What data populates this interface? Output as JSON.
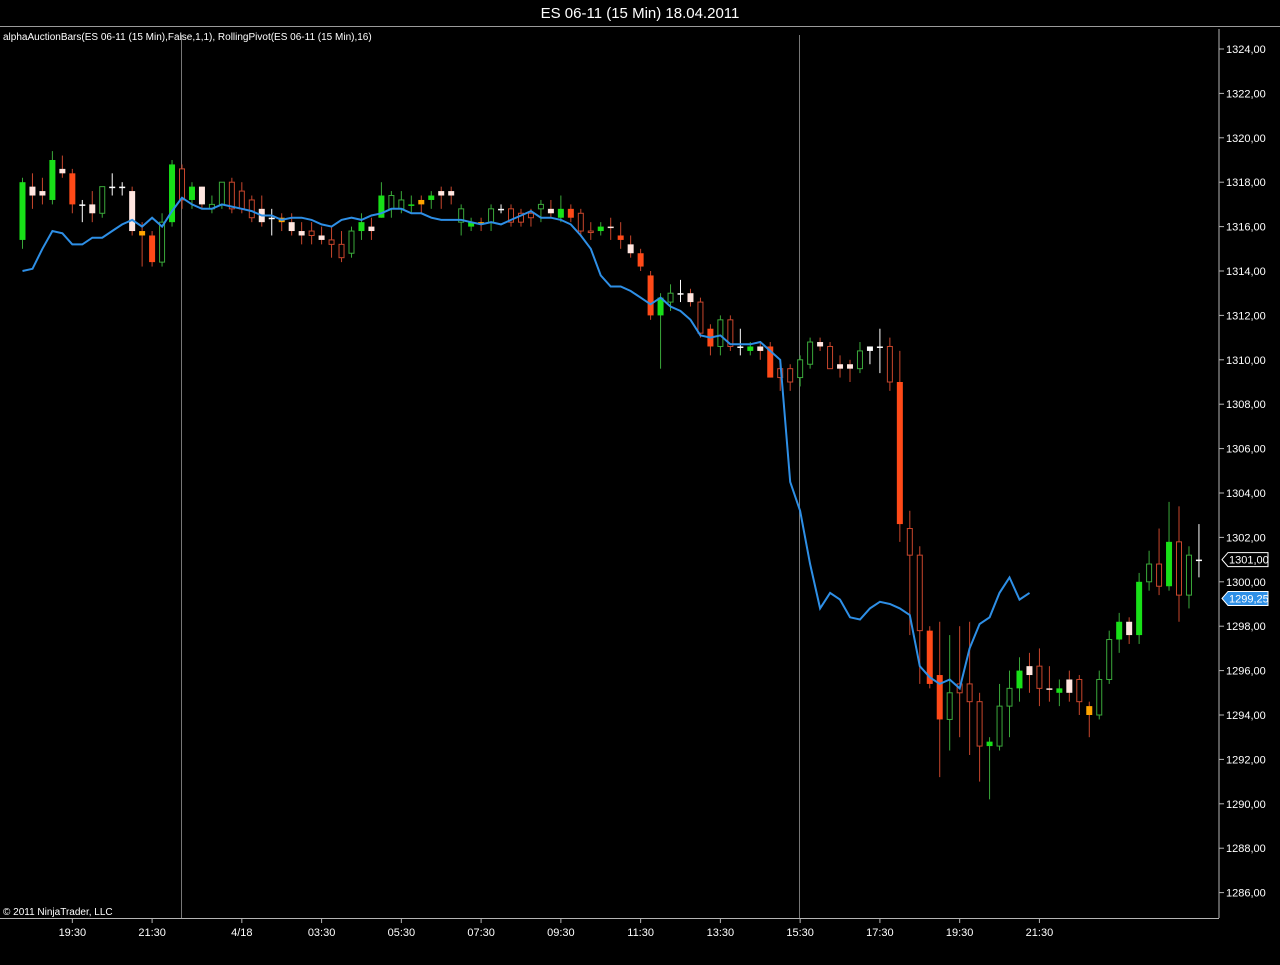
{
  "window": {
    "title": "ES 06-11 (15 Min)  18.04.2011"
  },
  "indicator_label": "alphaAuctionBars(ES 06-11 (15 Min),False,1,1), RollingPivot(ES 06-11 (15 Min),16)",
  "copyright": "© 2011 NinjaTrader, LLC",
  "price_markers": {
    "last_price": "1301,00",
    "pivot_value": "1299,25"
  },
  "colors": {
    "background": "#000000",
    "bull_strong": "#18e018",
    "bear_strong": "#ff4a18",
    "bull_wick": "#3aa83a",
    "bear_wick": "#c8462c",
    "neutral_body": "#ffe6e0",
    "pivot_line": "#2e8fe6",
    "axis_frame": "#b4b4b4",
    "session_line": "#777777"
  },
  "chart_data": {
    "type": "candlestick",
    "title": "ES 06-11 (15 Min)  18.04.2011",
    "instrument": "ES 06-11",
    "ylim": [
      1285,
      1325
    ],
    "grid": false,
    "y_ticks": [
      "1324,00",
      "1322,00",
      "1320,00",
      "1318,00",
      "1316,00",
      "1314,00",
      "1312,00",
      "1310,00",
      "1308,00",
      "1306,00",
      "1304,00",
      "1302,00",
      "1300,00",
      "1298,00",
      "1296,00",
      "1294,00",
      "1292,00",
      "1290,00",
      "1288,00",
      "1286,00"
    ],
    "x_tick_labels": [
      {
        "label": "19:30",
        "bar": 5
      },
      {
        "label": "21:30",
        "bar": 13
      },
      {
        "label": "4/18",
        "bar": 22
      },
      {
        "label": "03:30",
        "bar": 30
      },
      {
        "label": "05:30",
        "bar": 38
      },
      {
        "label": "07:30",
        "bar": 46
      },
      {
        "label": "09:30",
        "bar": 54
      },
      {
        "label": "11:30",
        "bar": 62
      },
      {
        "label": "13:30",
        "bar": 70
      },
      {
        "label": "15:30",
        "bar": 78
      },
      {
        "label": "17:30",
        "bar": 86
      },
      {
        "label": "19:30",
        "bar": 94
      },
      {
        "label": "21:30",
        "bar": 102
      }
    ],
    "session_break_bars": [
      16,
      78
    ],
    "candles": [
      {
        "o": 1315.4,
        "h": 1318.2,
        "l": 1315.0,
        "c": 1318.0,
        "k": "bull"
      },
      {
        "o": 1317.8,
        "h": 1318.4,
        "l": 1316.8,
        "c": 1317.4,
        "k": "neutral"
      },
      {
        "o": 1317.6,
        "h": 1318.2,
        "l": 1317.0,
        "c": 1317.4,
        "k": "neutral"
      },
      {
        "o": 1317.2,
        "h": 1319.4,
        "l": 1317.0,
        "c": 1319.0,
        "k": "bull"
      },
      {
        "o": 1318.6,
        "h": 1319.2,
        "l": 1318.2,
        "c": 1318.4,
        "k": "neutral"
      },
      {
        "o": 1318.4,
        "h": 1318.6,
        "l": 1316.6,
        "c": 1317.0,
        "k": "bear"
      },
      {
        "o": 1317.0,
        "h": 1317.2,
        "l": 1316.2,
        "c": 1317.0,
        "k": "doji"
      },
      {
        "o": 1317.0,
        "h": 1317.6,
        "l": 1316.2,
        "c": 1316.6,
        "k": "neutral"
      },
      {
        "o": 1316.6,
        "h": 1317.8,
        "l": 1316.4,
        "c": 1317.8,
        "k": "bull_hollow"
      },
      {
        "o": 1317.8,
        "h": 1318.4,
        "l": 1317.4,
        "c": 1317.8,
        "k": "doji"
      },
      {
        "o": 1317.8,
        "h": 1318.0,
        "l": 1317.4,
        "c": 1317.8,
        "k": "doji"
      },
      {
        "o": 1317.6,
        "h": 1317.8,
        "l": 1315.6,
        "c": 1315.8,
        "k": "neutral"
      },
      {
        "o": 1315.8,
        "h": 1316.2,
        "l": 1314.2,
        "c": 1315.6,
        "k": "neutral_orange"
      },
      {
        "o": 1315.6,
        "h": 1315.8,
        "l": 1314.2,
        "c": 1314.4,
        "k": "bear"
      },
      {
        "o": 1314.4,
        "h": 1316.6,
        "l": 1314.2,
        "c": 1316.2,
        "k": "bull_hollow"
      },
      {
        "o": 1316.2,
        "h": 1319.0,
        "l": 1316.0,
        "c": 1318.8,
        "k": "bull"
      },
      {
        "o": 1318.6,
        "h": 1318.8,
        "l": 1316.8,
        "c": 1317.2,
        "k": "bear_hollow"
      },
      {
        "o": 1317.2,
        "h": 1318.0,
        "l": 1316.8,
        "c": 1317.8,
        "k": "bull"
      },
      {
        "o": 1317.8,
        "h": 1317.8,
        "l": 1316.8,
        "c": 1317.0,
        "k": "neutral"
      },
      {
        "o": 1316.8,
        "h": 1317.4,
        "l": 1316.6,
        "c": 1317.0,
        "k": "bull_hollow"
      },
      {
        "o": 1317.0,
        "h": 1318.0,
        "l": 1316.8,
        "c": 1318.0,
        "k": "bull_hollow"
      },
      {
        "o": 1318.0,
        "h": 1318.2,
        "l": 1316.6,
        "c": 1316.8,
        "k": "bear_hollow"
      },
      {
        "o": 1316.8,
        "h": 1318.0,
        "l": 1316.6,
        "c": 1317.6,
        "k": "bear_hollow"
      },
      {
        "o": 1317.2,
        "h": 1317.4,
        "l": 1316.2,
        "c": 1316.4,
        "k": "bear_hollow"
      },
      {
        "o": 1316.8,
        "h": 1317.4,
        "l": 1316.0,
        "c": 1316.2,
        "k": "neutral"
      },
      {
        "o": 1316.4,
        "h": 1316.8,
        "l": 1315.6,
        "c": 1316.4,
        "k": "doji"
      },
      {
        "o": 1316.4,
        "h": 1316.6,
        "l": 1315.8,
        "c": 1316.2,
        "k": "neutral_orange"
      },
      {
        "o": 1316.2,
        "h": 1316.6,
        "l": 1315.6,
        "c": 1315.8,
        "k": "neutral"
      },
      {
        "o": 1315.8,
        "h": 1316.2,
        "l": 1315.2,
        "c": 1315.6,
        "k": "neutral"
      },
      {
        "o": 1315.6,
        "h": 1316.2,
        "l": 1315.2,
        "c": 1315.8,
        "k": "bear_hollow"
      },
      {
        "o": 1315.6,
        "h": 1316.0,
        "l": 1315.2,
        "c": 1315.4,
        "k": "neutral"
      },
      {
        "o": 1315.4,
        "h": 1316.0,
        "l": 1314.6,
        "c": 1315.2,
        "k": "bear_hollow"
      },
      {
        "o": 1314.6,
        "h": 1315.8,
        "l": 1314.4,
        "c": 1315.2,
        "k": "bear_hollow"
      },
      {
        "o": 1314.8,
        "h": 1316.0,
        "l": 1314.6,
        "c": 1315.8,
        "k": "bull_hollow"
      },
      {
        "o": 1315.8,
        "h": 1316.6,
        "l": 1315.4,
        "c": 1316.2,
        "k": "bull"
      },
      {
        "o": 1315.8,
        "h": 1316.4,
        "l": 1315.4,
        "c": 1316.0,
        "k": "neutral"
      },
      {
        "o": 1316.4,
        "h": 1318.0,
        "l": 1316.4,
        "c": 1317.4,
        "k": "bull"
      },
      {
        "o": 1317.4,
        "h": 1317.6,
        "l": 1316.4,
        "c": 1316.8,
        "k": "bull_hollow"
      },
      {
        "o": 1316.8,
        "h": 1317.6,
        "l": 1316.6,
        "c": 1317.2,
        "k": "bull_hollow"
      },
      {
        "o": 1317.0,
        "h": 1317.4,
        "l": 1316.6,
        "c": 1317.0,
        "k": "bull"
      },
      {
        "o": 1317.2,
        "h": 1317.4,
        "l": 1316.6,
        "c": 1317.0,
        "k": "neutral_orange"
      },
      {
        "o": 1317.2,
        "h": 1317.6,
        "l": 1316.8,
        "c": 1317.4,
        "k": "bull"
      },
      {
        "o": 1317.4,
        "h": 1317.8,
        "l": 1316.8,
        "c": 1317.6,
        "k": "neutral"
      },
      {
        "o": 1317.4,
        "h": 1317.8,
        "l": 1317.0,
        "c": 1317.6,
        "k": "neutral"
      },
      {
        "o": 1316.8,
        "h": 1317.0,
        "l": 1315.6,
        "c": 1316.2,
        "k": "bull_hollow"
      },
      {
        "o": 1316.0,
        "h": 1316.4,
        "l": 1315.8,
        "c": 1316.2,
        "k": "bull"
      },
      {
        "o": 1316.2,
        "h": 1316.4,
        "l": 1315.8,
        "c": 1316.2,
        "k": "neutral_orange"
      },
      {
        "o": 1316.2,
        "h": 1317.0,
        "l": 1315.8,
        "c": 1316.8,
        "k": "bull_hollow"
      },
      {
        "o": 1316.8,
        "h": 1317.0,
        "l": 1316.6,
        "c": 1316.8,
        "k": "doji"
      },
      {
        "o": 1316.8,
        "h": 1317.0,
        "l": 1316.0,
        "c": 1316.2,
        "k": "bear_hollow"
      },
      {
        "o": 1316.2,
        "h": 1316.8,
        "l": 1316.0,
        "c": 1316.6,
        "k": "bear_hollow"
      },
      {
        "o": 1316.6,
        "h": 1316.8,
        "l": 1316.0,
        "c": 1316.4,
        "k": "bear_hollow"
      },
      {
        "o": 1316.8,
        "h": 1317.2,
        "l": 1316.2,
        "c": 1317.0,
        "k": "bull_hollow"
      },
      {
        "o": 1316.6,
        "h": 1317.2,
        "l": 1316.4,
        "c": 1316.8,
        "k": "neutral"
      },
      {
        "o": 1316.4,
        "h": 1317.4,
        "l": 1316.2,
        "c": 1316.8,
        "k": "bull"
      },
      {
        "o": 1316.8,
        "h": 1317.0,
        "l": 1316.2,
        "c": 1316.4,
        "k": "bear"
      },
      {
        "o": 1316.6,
        "h": 1316.8,
        "l": 1315.6,
        "c": 1315.8,
        "k": "bear_hollow"
      },
      {
        "o": 1315.8,
        "h": 1316.2,
        "l": 1315.4,
        "c": 1315.8,
        "k": "bear_hollow"
      },
      {
        "o": 1316.0,
        "h": 1316.2,
        "l": 1315.6,
        "c": 1315.8,
        "k": "bull"
      },
      {
        "o": 1316.0,
        "h": 1316.4,
        "l": 1315.4,
        "c": 1316.0,
        "k": "neutral"
      },
      {
        "o": 1315.6,
        "h": 1316.2,
        "l": 1315.0,
        "c": 1315.4,
        "k": "bear"
      },
      {
        "o": 1315.2,
        "h": 1315.6,
        "l": 1314.6,
        "c": 1314.8,
        "k": "neutral"
      },
      {
        "o": 1314.8,
        "h": 1315.0,
        "l": 1314.0,
        "c": 1314.2,
        "k": "bear"
      },
      {
        "o": 1313.8,
        "h": 1314.0,
        "l": 1311.8,
        "c": 1312.0,
        "k": "bear"
      },
      {
        "o": 1312.0,
        "h": 1313.0,
        "l": 1309.6,
        "c": 1312.8,
        "k": "bull"
      },
      {
        "o": 1312.6,
        "h": 1313.4,
        "l": 1312.2,
        "c": 1313.0,
        "k": "bull_hollow"
      },
      {
        "o": 1313.0,
        "h": 1313.6,
        "l": 1312.6,
        "c": 1313.0,
        "k": "doji"
      },
      {
        "o": 1313.0,
        "h": 1313.2,
        "l": 1312.4,
        "c": 1312.6,
        "k": "neutral"
      },
      {
        "o": 1312.6,
        "h": 1312.8,
        "l": 1311.0,
        "c": 1311.2,
        "k": "bear_hollow"
      },
      {
        "o": 1311.4,
        "h": 1311.6,
        "l": 1310.2,
        "c": 1310.6,
        "k": "bear"
      },
      {
        "o": 1310.6,
        "h": 1312.0,
        "l": 1310.2,
        "c": 1311.8,
        "k": "bull_hollow"
      },
      {
        "o": 1311.8,
        "h": 1312.0,
        "l": 1310.4,
        "c": 1310.6,
        "k": "bear_hollow"
      },
      {
        "o": 1310.6,
        "h": 1311.4,
        "l": 1310.2,
        "c": 1310.6,
        "k": "doji"
      },
      {
        "o": 1310.6,
        "h": 1310.8,
        "l": 1310.2,
        "c": 1310.4,
        "k": "bull"
      },
      {
        "o": 1310.4,
        "h": 1310.8,
        "l": 1310.0,
        "c": 1310.6,
        "k": "neutral"
      },
      {
        "o": 1310.6,
        "h": 1310.8,
        "l": 1309.2,
        "c": 1309.2,
        "k": "bear"
      },
      {
        "o": 1309.2,
        "h": 1309.8,
        "l": 1308.6,
        "c": 1309.6,
        "k": "bear_hollow"
      },
      {
        "o": 1309.6,
        "h": 1309.8,
        "l": 1308.6,
        "c": 1309.0,
        "k": "bear_hollow"
      },
      {
        "o": 1309.2,
        "h": 1310.2,
        "l": 1308.8,
        "c": 1310.0,
        "k": "bull_hollow"
      },
      {
        "o": 1309.8,
        "h": 1311.0,
        "l": 1309.6,
        "c": 1310.8,
        "k": "bull_hollow"
      },
      {
        "o": 1310.8,
        "h": 1311.0,
        "l": 1310.4,
        "c": 1310.6,
        "k": "neutral"
      },
      {
        "o": 1310.6,
        "h": 1310.8,
        "l": 1309.6,
        "c": 1309.6,
        "k": "bear_hollow"
      },
      {
        "o": 1309.6,
        "h": 1310.2,
        "l": 1309.2,
        "c": 1309.8,
        "k": "neutral"
      },
      {
        "o": 1309.8,
        "h": 1310.0,
        "l": 1309.0,
        "c": 1309.6,
        "k": "neutral"
      },
      {
        "o": 1309.6,
        "h": 1310.8,
        "l": 1309.4,
        "c": 1310.4,
        "k": "bull_hollow"
      },
      {
        "o": 1310.4,
        "h": 1310.6,
        "l": 1309.8,
        "c": 1310.6,
        "k": "doji"
      },
      {
        "o": 1310.6,
        "h": 1311.4,
        "l": 1309.4,
        "c": 1310.6,
        "k": "doji"
      },
      {
        "o": 1310.6,
        "h": 1311.0,
        "l": 1308.6,
        "c": 1309.0,
        "k": "bear_hollow"
      },
      {
        "o": 1309.0,
        "h": 1310.4,
        "l": 1301.8,
        "c": 1302.6,
        "k": "bear"
      }
    ],
    "candles_part2": [
      {
        "o": 1302.4,
        "h": 1303.2,
        "l": 1297.6,
        "c": 1301.2,
        "k": "bear_hollow"
      },
      {
        "o": 1301.2,
        "h": 1301.6,
        "l": 1295.4,
        "c": 1297.8,
        "k": "bear_hollow"
      },
      {
        "o": 1297.8,
        "h": 1298.0,
        "l": 1295.2,
        "c": 1295.4,
        "k": "bear"
      },
      {
        "o": 1295.8,
        "h": 1298.2,
        "l": 1291.2,
        "c": 1293.8,
        "k": "bear"
      },
      {
        "o": 1293.8,
        "h": 1297.6,
        "l": 1292.4,
        "c": 1295.0,
        "k": "bull_hollow"
      },
      {
        "o": 1295.0,
        "h": 1298.0,
        "l": 1293.0,
        "c": 1295.4,
        "k": "bear_hollow"
      },
      {
        "o": 1295.4,
        "h": 1298.2,
        "l": 1292.2,
        "c": 1294.6,
        "k": "bear_hollow"
      },
      {
        "o": 1294.6,
        "h": 1295.0,
        "l": 1291.0,
        "c": 1292.6,
        "k": "bear_hollow"
      },
      {
        "o": 1292.6,
        "h": 1293.0,
        "l": 1290.2,
        "c": 1292.8,
        "k": "bull"
      },
      {
        "o": 1292.6,
        "h": 1295.4,
        "l": 1292.4,
        "c": 1294.4,
        "k": "bull_hollow"
      },
      {
        "o": 1294.4,
        "h": 1296.0,
        "l": 1293.0,
        "c": 1295.2,
        "k": "bull_hollow"
      },
      {
        "o": 1295.2,
        "h": 1296.6,
        "l": 1294.6,
        "c": 1296.0,
        "k": "bull"
      },
      {
        "o": 1295.8,
        "h": 1296.8,
        "l": 1295.0,
        "c": 1296.2,
        "k": "neutral"
      },
      {
        "o": 1296.2,
        "h": 1297.0,
        "l": 1294.4,
        "c": 1295.2,
        "k": "bear_hollow"
      },
      {
        "o": 1295.2,
        "h": 1296.2,
        "l": 1294.6,
        "c": 1295.2,
        "k": "neutral"
      },
      {
        "o": 1295.0,
        "h": 1295.6,
        "l": 1294.4,
        "c": 1295.2,
        "k": "bull"
      },
      {
        "o": 1295.0,
        "h": 1296.0,
        "l": 1294.6,
        "c": 1295.6,
        "k": "neutral"
      },
      {
        "o": 1295.6,
        "h": 1295.8,
        "l": 1294.0,
        "c": 1294.6,
        "k": "bear_hollow"
      },
      {
        "o": 1294.4,
        "h": 1294.6,
        "l": 1293.0,
        "c": 1294.0,
        "k": "neutral_orange"
      },
      {
        "o": 1294.0,
        "h": 1296.0,
        "l": 1293.8,
        "c": 1295.6,
        "k": "bull_hollow"
      },
      {
        "o": 1295.6,
        "h": 1297.8,
        "l": 1295.4,
        "c": 1297.4,
        "k": "bull_hollow"
      },
      {
        "o": 1297.4,
        "h": 1298.6,
        "l": 1296.8,
        "c": 1298.2,
        "k": "bull"
      },
      {
        "o": 1298.2,
        "h": 1298.4,
        "l": 1297.2,
        "c": 1297.6,
        "k": "neutral"
      },
      {
        "o": 1297.6,
        "h": 1300.4,
        "l": 1297.2,
        "c": 1300.0,
        "k": "bull"
      },
      {
        "o": 1300.0,
        "h": 1301.4,
        "l": 1299.6,
        "c": 1300.8,
        "k": "bull_hollow"
      },
      {
        "o": 1300.8,
        "h": 1302.4,
        "l": 1299.4,
        "c": 1299.8,
        "k": "bear_hollow"
      },
      {
        "o": 1299.8,
        "h": 1303.6,
        "l": 1299.6,
        "c": 1301.8,
        "k": "bull"
      },
      {
        "o": 1301.8,
        "h": 1303.4,
        "l": 1298.2,
        "c": 1299.4,
        "k": "bear_hollow"
      },
      {
        "o": 1299.4,
        "h": 1301.6,
        "l": 1298.8,
        "c": 1301.2,
        "k": "bull_hollow"
      },
      {
        "o": 1301.0,
        "h": 1302.6,
        "l": 1300.2,
        "c": 1301.0,
        "k": "doji"
      }
    ],
    "series": [
      {
        "name": "RollingPivot(ES 06-11 (15 Min),16)",
        "values": [
          1314.0,
          1314.1,
          1315.0,
          1315.8,
          1315.7,
          1315.2,
          1315.2,
          1315.5,
          1315.5,
          1315.8,
          1316.1,
          1316.3,
          1316.0,
          1316.4,
          1316.0,
          1316.7,
          1317.3,
          1317.0,
          1316.8,
          1316.8,
          1317.0,
          1316.9,
          1316.8,
          1316.7,
          1316.5,
          1316.5,
          1316.3,
          1316.4,
          1316.4,
          1316.3,
          1316.1,
          1316.0,
          1316.3,
          1316.4,
          1316.3,
          1316.5,
          1316.6,
          1316.8,
          1316.8,
          1316.6,
          1316.6,
          1316.4,
          1316.3,
          1316.3,
          1316.3,
          1316.2,
          1316.1,
          1316.2,
          1316.1,
          1316.3,
          1316.5,
          1316.7,
          1316.4,
          1316.4,
          1316.3,
          1316.1,
          1315.6,
          1315.0,
          1313.8,
          1313.3,
          1313.3,
          1313.1,
          1312.8,
          1312.5,
          1312.8,
          1312.4,
          1312.2,
          1311.8,
          1311.1,
          1311.0,
          1311.1,
          1310.7,
          1310.7,
          1310.7,
          1310.8,
          1310.4,
          1310.0,
          1304.5,
          1303.2,
          1300.8,
          1298.8,
          1299.5,
          1299.2,
          1298.4,
          1298.3,
          1298.8,
          1299.1,
          1299.0,
          1298.8,
          1298.5,
          1296.2,
          1295.7,
          1295.4,
          1295.6,
          1295.2,
          1297.0,
          1298.1,
          1298.4,
          1299.5,
          1300.2,
          1299.2,
          1299.5
        ],
        "color": "#2e8fe6"
      }
    ]
  }
}
